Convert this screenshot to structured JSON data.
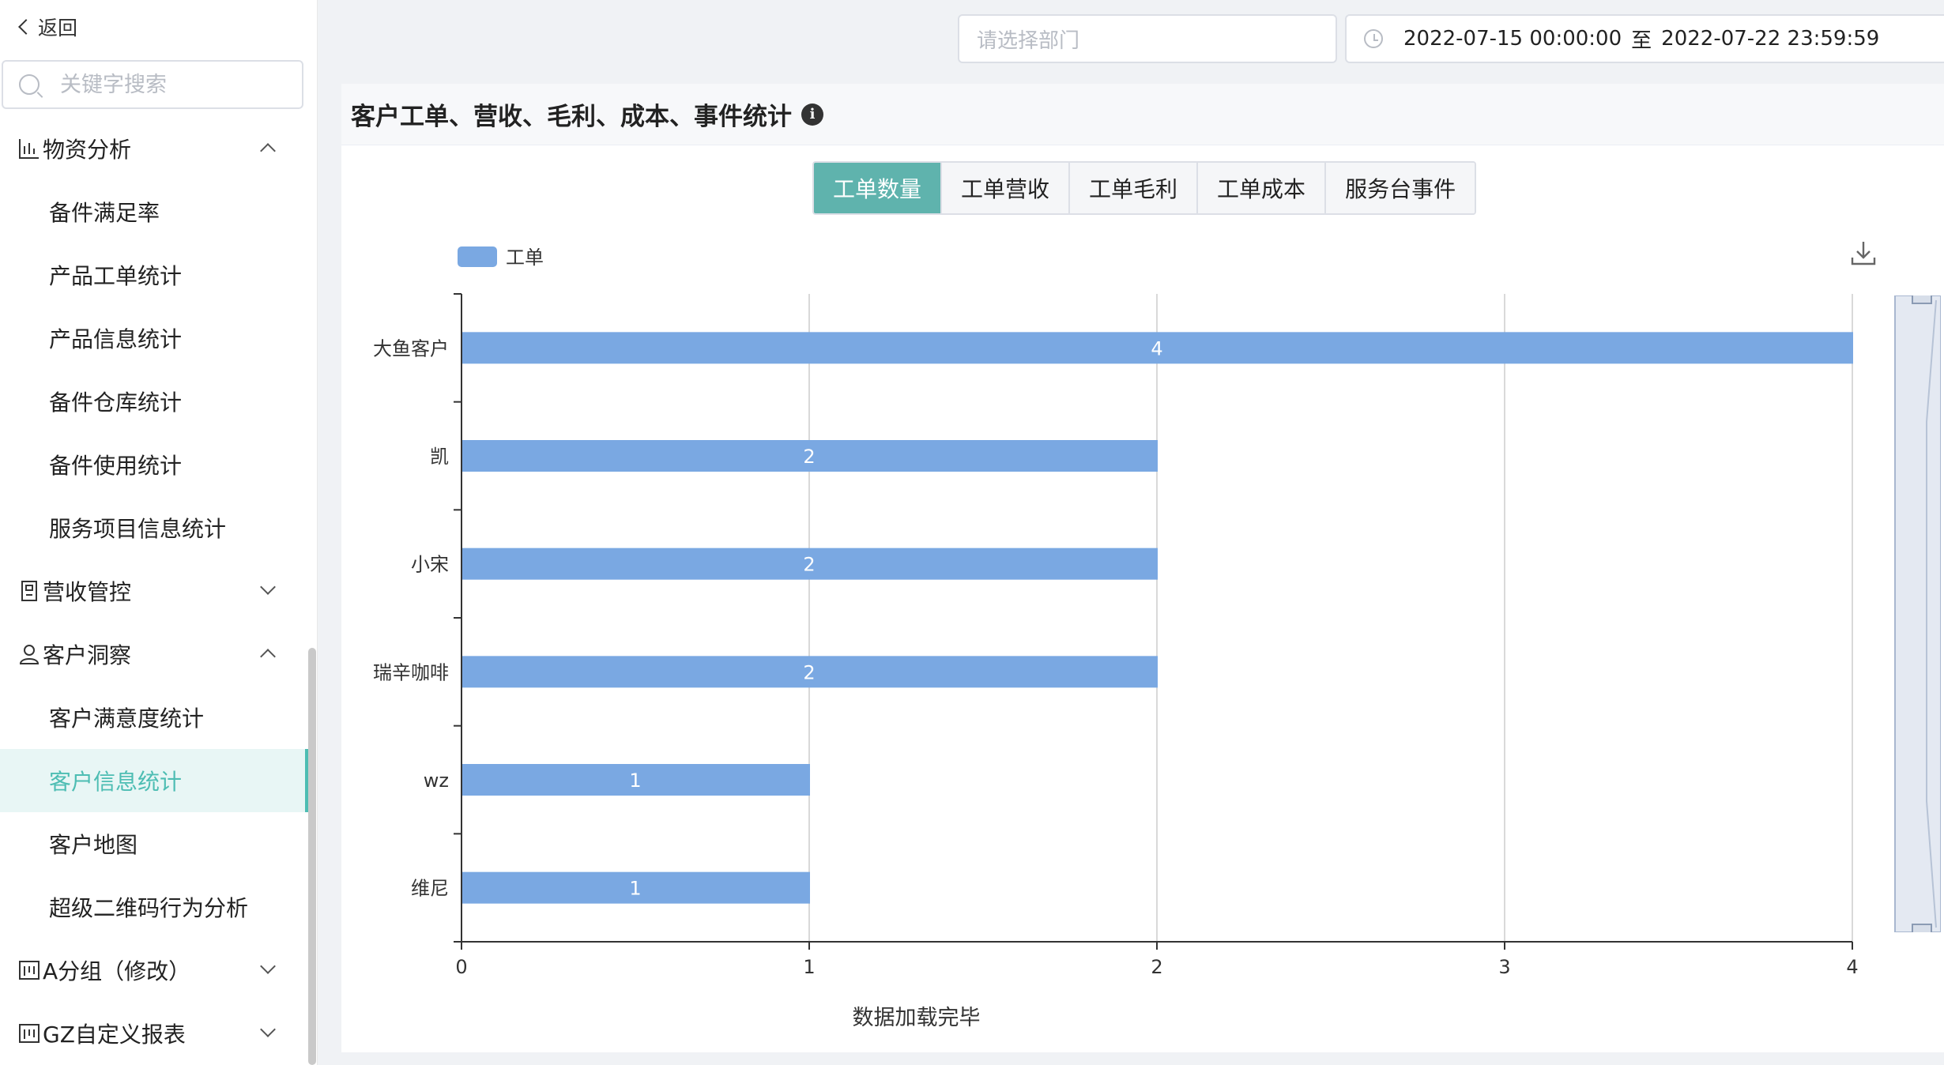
{
  "sidebar": {
    "back_label": "返回",
    "search_placeholder": "关键字搜索",
    "groups": [
      {
        "label": "物资分析",
        "icon": "bar-chart-icon",
        "expanded": true,
        "items": [
          "备件满足率",
          "产品工单统计",
          "产品信息统计",
          "备件仓库统计",
          "备件使用统计",
          "服务项目信息统计"
        ]
      },
      {
        "label": "营收管控",
        "icon": "building-icon",
        "expanded": false,
        "items": []
      },
      {
        "label": "客户洞察",
        "icon": "user-icon",
        "expanded": true,
        "items": [
          "客户满意度统计",
          "客户信息统计",
          "客户地图",
          "超级二维码行为分析"
        ]
      },
      {
        "label": "A分组（修改）",
        "icon": "board-icon",
        "expanded": false,
        "items": []
      },
      {
        "label": "GZ自定义报表",
        "icon": "board-icon",
        "expanded": false,
        "items": []
      }
    ],
    "active_item": "客户信息统计"
  },
  "filters": {
    "dept_placeholder": "请选择部门",
    "date_start": "2022-07-15 00:00:00",
    "date_separator": "至",
    "date_end": "2022-07-22 23:59:59"
  },
  "panel": {
    "title": "客户工单、营收、毛利、成本、事件统计",
    "info_glyph": "i",
    "tabs": [
      "工单数量",
      "工单营收",
      "工单毛利",
      "工单成本",
      "服务台事件"
    ],
    "active_tab": "工单数量",
    "status_text": "数据加载完毕"
  },
  "colors": {
    "accent": "#4dbdb3",
    "bar": "#7aa8e2"
  },
  "chart_data": {
    "type": "bar",
    "orientation": "horizontal",
    "categories": [
      "大鱼客户",
      "凯",
      "小宋",
      "瑞辛咖啡",
      "wz",
      "维尼"
    ],
    "series": [
      {
        "name": "工单",
        "values": [
          4,
          2,
          2,
          2,
          1,
          1
        ]
      }
    ],
    "xlim": [
      0,
      4
    ],
    "xticks": [
      "0",
      "1",
      "2",
      "3",
      "4"
    ],
    "grid": true,
    "legend": "top-left",
    "data_labels": true
  }
}
